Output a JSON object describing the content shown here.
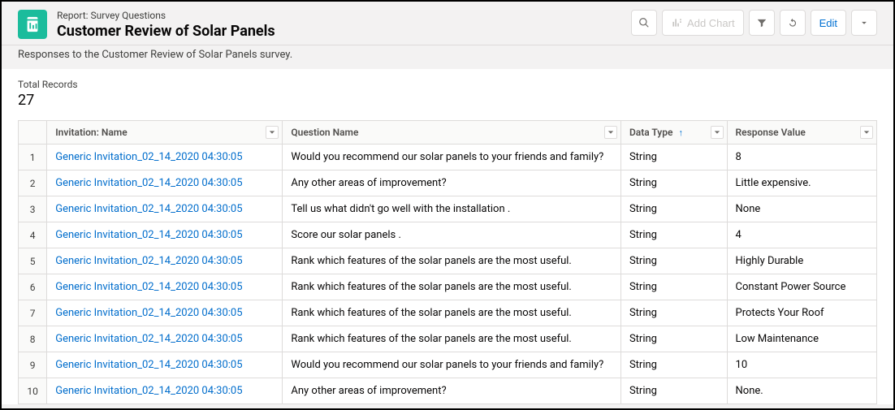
{
  "header": {
    "eyebrow": "Report: Survey Questions",
    "title": "Customer Review of Solar Panels",
    "description": "Responses to the Customer Review of Solar Panels survey."
  },
  "toolbar": {
    "add_chart": "Add Chart",
    "edit": "Edit"
  },
  "summary": {
    "label": "Total Records",
    "value": "27"
  },
  "columns": {
    "invitation": "Invitation: Name",
    "question": "Question Name",
    "data_type": "Data Type",
    "response": "Response Value"
  },
  "rows": [
    {
      "n": "1",
      "inv": "Generic Invitation_02_14_2020 04:30:05",
      "q": "Would you recommend our solar panels to your friends and family?",
      "dt": "String",
      "rv": "8"
    },
    {
      "n": "2",
      "inv": "Generic Invitation_02_14_2020 04:30:05",
      "q": "Any other areas of improvement?",
      "dt": "String",
      "rv": "Little expensive."
    },
    {
      "n": "3",
      "inv": "Generic Invitation_02_14_2020 04:30:05",
      "q": "Tell us what didn't go well with the installation .",
      "dt": "String",
      "rv": "None"
    },
    {
      "n": "4",
      "inv": "Generic Invitation_02_14_2020 04:30:05",
      "q": "Score our solar panels .",
      "dt": "String",
      "rv": "4"
    },
    {
      "n": "5",
      "inv": "Generic Invitation_02_14_2020 04:30:05",
      "q": "Rank which features of the solar panels are the most useful.",
      "dt": "String",
      "rv": "Highly Durable"
    },
    {
      "n": "6",
      "inv": "Generic Invitation_02_14_2020 04:30:05",
      "q": "Rank which features of the solar panels are the most useful.",
      "dt": "String",
      "rv": "Constant Power Source"
    },
    {
      "n": "7",
      "inv": "Generic Invitation_02_14_2020 04:30:05",
      "q": "Rank which features of the solar panels are the most useful.",
      "dt": "String",
      "rv": "Protects Your Roof"
    },
    {
      "n": "8",
      "inv": "Generic Invitation_02_14_2020 04:30:05",
      "q": "Rank which features of the solar panels are the most useful.",
      "dt": "String",
      "rv": "Low Maintenance"
    },
    {
      "n": "9",
      "inv": "Generic Invitation_02_14_2020 04:30:05",
      "q": "Would you recommend our solar panels to your friends and family?",
      "dt": "String",
      "rv": "10"
    },
    {
      "n": "10",
      "inv": "Generic Invitation_02_14_2020 04:30:05",
      "q": "Any other areas of improvement?",
      "dt": "String",
      "rv": "None."
    }
  ]
}
